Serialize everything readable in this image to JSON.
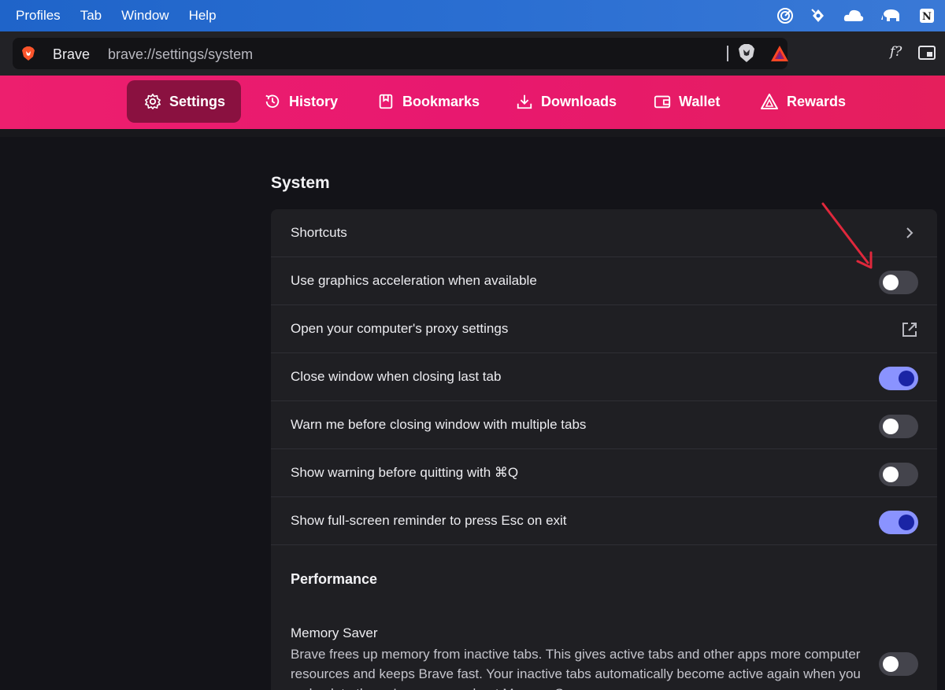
{
  "menubar": {
    "items": [
      "Profiles",
      "Tab",
      "Window",
      "Help"
    ],
    "status_icons": [
      "target-icon",
      "radar-icon",
      "cloud-icon",
      "elephant-icon",
      "notion-icon"
    ]
  },
  "omnibox": {
    "site_name": "Brave",
    "url": "brave://settings/system",
    "extension_label": "f?"
  },
  "settings_nav": {
    "tabs": [
      {
        "label": "Settings",
        "icon": "gear-icon",
        "active": true
      },
      {
        "label": "History",
        "icon": "history-icon",
        "active": false
      },
      {
        "label": "Bookmarks",
        "icon": "bookmark-icon",
        "active": false
      },
      {
        "label": "Downloads",
        "icon": "download-icon",
        "active": false
      },
      {
        "label": "Wallet",
        "icon": "wallet-icon",
        "active": false
      },
      {
        "label": "Rewards",
        "icon": "rewards-icon",
        "active": false
      }
    ]
  },
  "system": {
    "title": "System",
    "rows": [
      {
        "label": "Shortcuts",
        "control": "chevron"
      },
      {
        "label": "Use graphics acceleration when available",
        "control": "toggle",
        "on": false
      },
      {
        "label": "Open your computer's proxy settings",
        "control": "external-link"
      },
      {
        "label": "Close window when closing last tab",
        "control": "toggle",
        "on": true
      },
      {
        "label": "Warn me before closing window with multiple tabs",
        "control": "toggle",
        "on": false
      },
      {
        "label": "Show warning before quitting with ⌘Q",
        "control": "toggle",
        "on": false
      },
      {
        "label": "Show full-screen reminder to press Esc on exit",
        "control": "toggle",
        "on": true
      }
    ]
  },
  "performance": {
    "title": "Performance",
    "memory_saver": {
      "title": "Memory Saver",
      "description": "Brave frees up memory from inactive tabs. This gives active tabs and other apps more computer resources and keeps Brave fast. Your inactive tabs automatically become active again when you go back to them. Learn more about Memory Saver",
      "on": false
    }
  },
  "colors": {
    "nav_gradient_start": "#ed1f6e",
    "nav_active_tab": "#8a1140",
    "toggle_on_track": "#8a93ff",
    "toggle_on_knob": "#1a24a5",
    "annotation_arrow": "#e0283c"
  }
}
